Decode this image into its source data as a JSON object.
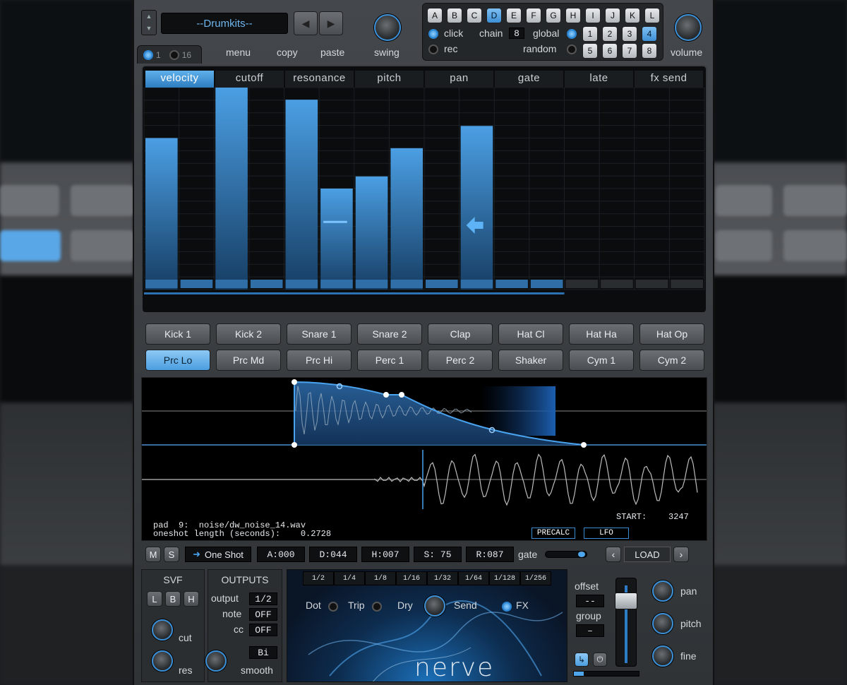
{
  "top": {
    "preset": "--Drumkits--",
    "pattern_count_a": "1",
    "pattern_count_b": "16",
    "menu": "menu",
    "copy": "copy",
    "paste": "paste",
    "swing": "swing",
    "volume": "volume",
    "letters": [
      "A",
      "B",
      "C",
      "D",
      "E",
      "F",
      "G",
      "H",
      "I",
      "J",
      "K",
      "L"
    ],
    "active_letter": "D",
    "click": "click",
    "rec": "rec",
    "chain": "chain",
    "chain_value": "8",
    "global": "global",
    "random": "random",
    "num_row1": [
      "1",
      "2",
      "3",
      "4"
    ],
    "num_row2": [
      "5",
      "6",
      "7",
      "8"
    ]
  },
  "tabs": [
    "velocity",
    "cutoff",
    "resonance",
    "pitch",
    "pan",
    "gate",
    "late",
    "fx send"
  ],
  "active_tab": "velocity",
  "step_values": [
    0.75,
    0,
    1.0,
    0,
    0.94,
    0.5,
    0.56,
    0.7,
    0,
    0.81,
    0,
    0,
    0,
    0,
    0,
    0
  ],
  "pads_row1": [
    "Kick 1",
    "Kick 2",
    "Snare 1",
    "Snare 2",
    "Clap",
    "Hat Cl",
    "Hat Ha",
    "Hat Op"
  ],
  "pads_row2": [
    "Prc Lo",
    "Prc Md",
    "Prc Hi",
    "Perc 1",
    "Perc 2",
    "Shaker",
    "Cym 1",
    "Cym 2"
  ],
  "active_pad": "Prc Lo",
  "wave": {
    "pad_line": "pad  9:  noise/dw_noise_14.wav",
    "length_line": "oneshot length (seconds):    0.2728",
    "start_label": "START:",
    "start_value": "3247",
    "precalc": "PRECALC",
    "lfo": "LFO"
  },
  "controls": {
    "m": "M",
    "s": "S",
    "mode": "One Shot",
    "a": "A:000",
    "d": "D:044",
    "h": "H:007",
    "sv": "S: 75",
    "r": "R:087",
    "gate": "gate",
    "load": "LOAD",
    "svf": "SVF",
    "filter_l": "L",
    "filter_b": "B",
    "filter_h": "H",
    "cut": "cut",
    "res": "res",
    "outputs": "OUTPUTS",
    "output": "output",
    "output_val": "1/2",
    "note": "note",
    "note_val": "OFF",
    "cc": "cc",
    "cc_val": "OFF",
    "bi": "Bi",
    "smooth": "smooth",
    "divisions": [
      "1/2",
      "1/4",
      "1/8",
      "1/16",
      "1/32",
      "1/64",
      "1/128",
      "1/256"
    ],
    "dot": "Dot",
    "trip": "Trip",
    "dry": "Dry",
    "send": "Send",
    "fx": "FX",
    "logo": "nerve",
    "offset": "offset",
    "offset_val": "--",
    "group": "group",
    "group_val": "–",
    "pan": "pan",
    "pitch": "pitch",
    "fine": "fine"
  }
}
